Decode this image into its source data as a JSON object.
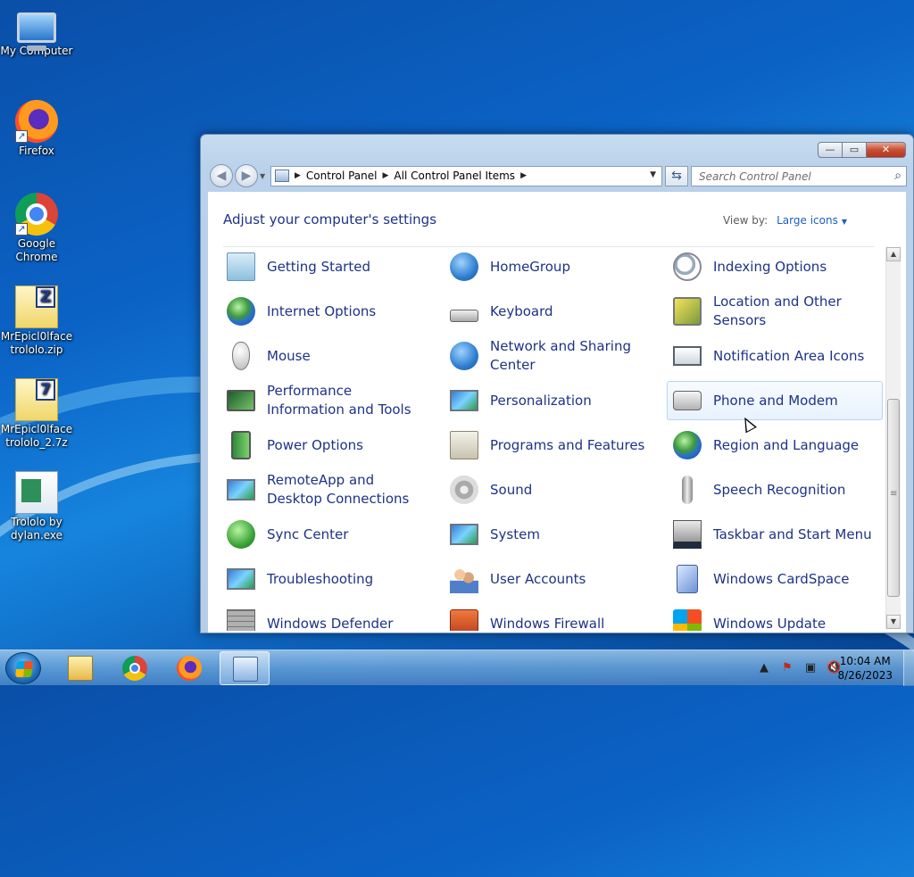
{
  "desktop": {
    "icons": [
      {
        "label": "My Computer",
        "icon": "computer-icon"
      },
      {
        "label": "Firefox",
        "icon": "firefox-icon"
      },
      {
        "label": "Google Chrome",
        "icon": "chrome-icon"
      },
      {
        "label": "MrEpicl0lface trololo.zip",
        "icon": "zip-archive-icon",
        "badge": "Z"
      },
      {
        "label": "MrEpicl0lface trololo_2.7z",
        "icon": "7z-archive-icon",
        "badge": "7"
      },
      {
        "label": "Trololo by dylan.exe",
        "icon": "exe-file-icon"
      }
    ]
  },
  "window": {
    "controls": {
      "minimize": "—",
      "maximize": "▭",
      "close": "✕"
    },
    "breadcrumb": [
      "Control Panel",
      "All Control Panel Items"
    ],
    "search_placeholder": "Search Control Panel",
    "header_title": "Adjust your computer's settings",
    "view_by_label": "View by:",
    "view_by_value": "Large icons",
    "items": [
      {
        "label": "Getting Started",
        "icon": "getting-started-icon"
      },
      {
        "label": "HomeGroup",
        "icon": "homegroup-icon"
      },
      {
        "label": "Indexing Options",
        "icon": "indexing-options-icon"
      },
      {
        "label": "Internet Options",
        "icon": "internet-options-icon"
      },
      {
        "label": "Keyboard",
        "icon": "keyboard-icon"
      },
      {
        "label": "Location and Other Sensors",
        "icon": "location-sensors-icon"
      },
      {
        "label": "Mouse",
        "icon": "mouse-icon"
      },
      {
        "label": "Network and Sharing Center",
        "icon": "network-sharing-icon"
      },
      {
        "label": "Notification Area Icons",
        "icon": "notification-area-icon"
      },
      {
        "label": "Performance Information and Tools",
        "icon": "performance-icon"
      },
      {
        "label": "Personalization",
        "icon": "personalization-icon"
      },
      {
        "label": "Phone and Modem",
        "icon": "phone-modem-icon"
      },
      {
        "label": "Power Options",
        "icon": "power-options-icon"
      },
      {
        "label": "Programs and Features",
        "icon": "programs-features-icon"
      },
      {
        "label": "Region and Language",
        "icon": "region-language-icon"
      },
      {
        "label": "RemoteApp and Desktop Connections",
        "icon": "remoteapp-icon"
      },
      {
        "label": "Sound",
        "icon": "sound-icon"
      },
      {
        "label": "Speech Recognition",
        "icon": "speech-recognition-icon"
      },
      {
        "label": "Sync Center",
        "icon": "sync-center-icon"
      },
      {
        "label": "System",
        "icon": "system-icon"
      },
      {
        "label": "Taskbar and Start Menu",
        "icon": "taskbar-start-menu-icon"
      },
      {
        "label": "Troubleshooting",
        "icon": "troubleshooting-icon"
      },
      {
        "label": "User Accounts",
        "icon": "user-accounts-icon"
      },
      {
        "label": "Windows CardSpace",
        "icon": "cardspace-icon"
      },
      {
        "label": "Windows Defender",
        "icon": "windows-defender-icon"
      },
      {
        "label": "Windows Firewall",
        "icon": "windows-firewall-icon"
      },
      {
        "label": "Windows Update",
        "icon": "windows-update-icon"
      }
    ],
    "hovered_item": "Phone and Modem"
  },
  "taskbar": {
    "apps": [
      "windows-explorer-icon",
      "chrome-icon",
      "firefox-icon",
      "control-panel-icon"
    ],
    "active_app": "control-panel-icon",
    "tray_icons": [
      "show-hidden-icons-icon",
      "action-center-icon",
      "network-icon",
      "volume-muted-icon"
    ],
    "time": "10:04 AM",
    "date": "8/26/2023"
  },
  "colors": {
    "link_text": "#1e3287",
    "accent_blue": "#1e5ec2",
    "close_button": "#c74f34"
  }
}
